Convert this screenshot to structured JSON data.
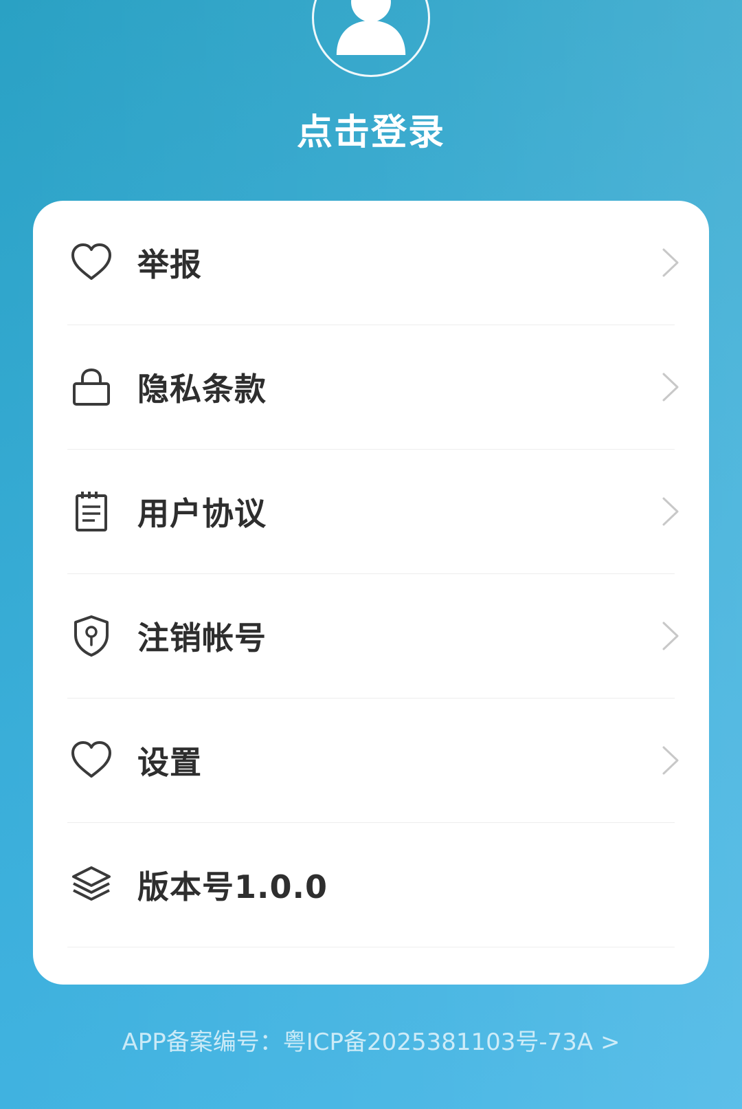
{
  "header": {
    "avatar_icon": "user-avatar-icon",
    "login_label": "点击登录"
  },
  "menu": {
    "items": [
      {
        "label": "举报",
        "icon": "heart-icon",
        "has_arrow": true
      },
      {
        "label": "隐私条款",
        "icon": "lock-icon",
        "has_arrow": true
      },
      {
        "label": "用户协议",
        "icon": "notepad-icon",
        "has_arrow": true
      },
      {
        "label": "注销帐号",
        "icon": "shield-key-icon",
        "has_arrow": true
      },
      {
        "label": "设置",
        "icon": "heart-icon",
        "has_arrow": true
      },
      {
        "label": "版本号1.0.0",
        "icon": "layers-icon",
        "has_arrow": false
      }
    ]
  },
  "footer": {
    "icp_text": "APP备案编号：粤ICP备2025381103号-73A >"
  },
  "colors": {
    "background_start": "#2aa1c4",
    "background_end": "#45b6e6",
    "card": "#ffffff",
    "label_text": "#2e2e2e",
    "chevron": "#c8c8c8"
  }
}
